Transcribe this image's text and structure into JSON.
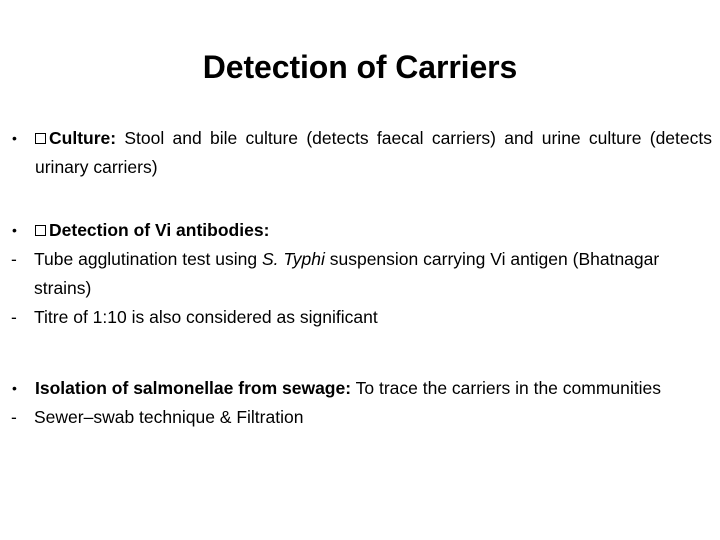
{
  "slide": {
    "title": "Detection of Carriers",
    "background_color": "#ffffff",
    "text_color": "#000000",
    "bullet_marker": "•",
    "dash_marker": "-",
    "content": [
      {
        "id": "culture",
        "marker": "•",
        "has_box_glyph": true,
        "lead_bold": "Culture:",
        "body": " Stool and bile culture (detects faecal carriers) and urine culture (detects urinary carriers)"
      },
      {
        "id": "vi-antibodies",
        "marker": "•",
        "has_box_glyph": true,
        "lead_bold": "Detection of Vi antibodies:",
        "body": ""
      },
      {
        "id": "tube-agglutination",
        "marker": "-",
        "has_box_glyph": false,
        "text_pre": "Tube agglutination test using ",
        "text_italic": "S. Typhi",
        "text_post": " suspension carrying Vi antigen (Bhatnagar strains)"
      },
      {
        "id": "titre",
        "marker": "-",
        "has_box_glyph": false,
        "text": "Titre of 1:10 is also considered as significant"
      },
      {
        "id": "sewage-isolation",
        "marker": "•",
        "has_box_glyph": false,
        "lead_bold": "Isolation of salmonellae from sewage:",
        "body": "  To trace the carriers in the communities"
      },
      {
        "id": "sewer-swab",
        "marker": "-",
        "has_box_glyph": false,
        "text": "Sewer–swab technique & Filtration"
      }
    ]
  }
}
